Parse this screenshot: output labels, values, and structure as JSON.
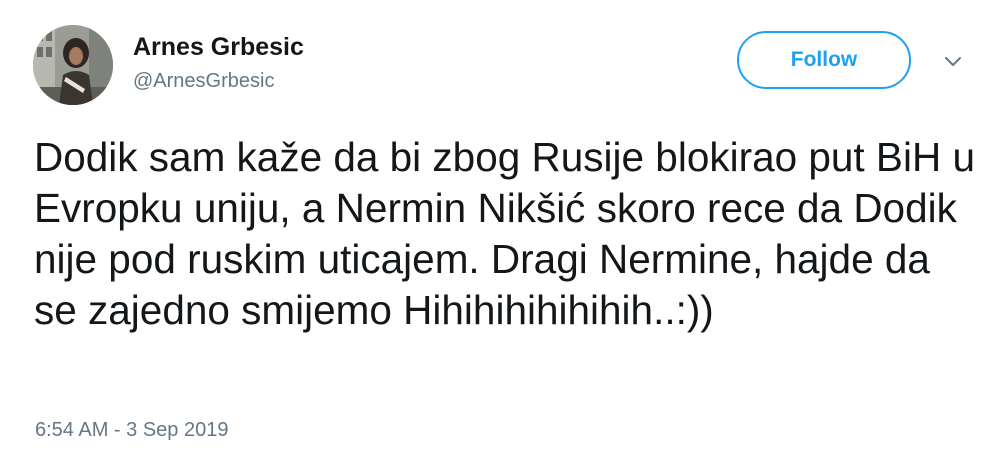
{
  "user": {
    "name": "Arnes Grbesic",
    "handle": "@ArnesGrbesic"
  },
  "follow_button": {
    "label": "Follow"
  },
  "menu": {
    "icon": "chevron-down-icon"
  },
  "tweet": {
    "text": "Dodik sam kaže da bi zbog Rusije blokirao put BiH u Evropku uniju, a Nermin Nikšić skoro rece da Dodik nije pod ruskim uticajem. Dragi Nermine, hajde da se zajedno smijemo Hihihihihihihih..:))",
    "timestamp": "6:54 AM - 3 Sep 2019"
  },
  "colors": {
    "accent": "#1da1f2",
    "text": "#14171a",
    "secondary_text": "#657786"
  }
}
